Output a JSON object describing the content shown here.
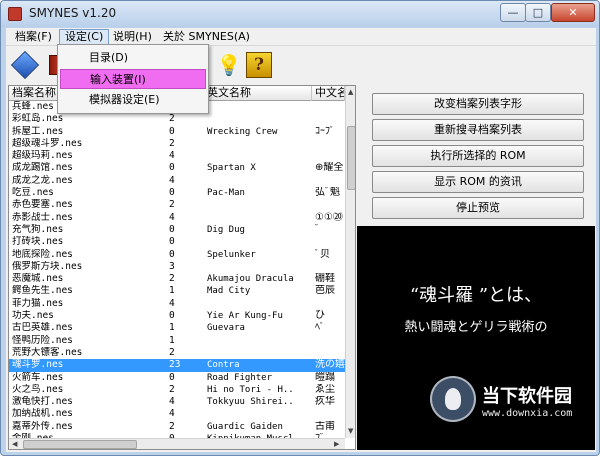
{
  "window": {
    "title": "SMYNES v1.20",
    "minimize": "—",
    "maximize": "□",
    "close": "✕"
  },
  "menu": [
    {
      "label": "档案(F)"
    },
    {
      "label": "设定(C)"
    },
    {
      "label": "说明(H)"
    },
    {
      "label": "关於 SMYNES(A)"
    }
  ],
  "dropdown": [
    "目录(D)",
    "输入装置(I)",
    "模拟器设定(E)"
  ],
  "toolbar": {
    "help_glyph": "?"
  },
  "columns": [
    "档案名称",
    "",
    "英文名称",
    "中文名"
  ],
  "rows": [
    {
      "file": "兵蜂.nes",
      "num": "0",
      "en": "",
      "cn": ""
    },
    {
      "file": "彩虹岛.nes",
      "num": "2",
      "en": "",
      "cn": ""
    },
    {
      "file": "拆屋工.nes",
      "num": "0",
      "en": "Wrecking Crew",
      "cn": "ｺｰﾌﾟ"
    },
    {
      "file": "超级魂斗罗.nes",
      "num": "2",
      "en": "",
      "cn": ""
    },
    {
      "file": "超级玛莉.nes",
      "num": "4",
      "en": "",
      "cn": ""
    },
    {
      "file": "成龙踢馆.nes",
      "num": "0",
      "en": "Spartan X",
      "cn": "⊕耀全"
    },
    {
      "file": "成龙之龙.nes",
      "num": "4",
      "en": "",
      "cn": ""
    },
    {
      "file": "吃豆.nes",
      "num": "0",
      "en": "Pac-Man",
      "cn": "弘ﾞ魁"
    },
    {
      "file": "赤色要塞.nes",
      "num": "2",
      "en": "",
      "cn": ""
    },
    {
      "file": "赤影战士.nes",
      "num": "4",
      "en": "",
      "cn": "①①⑳"
    },
    {
      "file": "充气狗.nes",
      "num": "0",
      "en": "Dig Dug",
      "cn": "ﾞ"
    },
    {
      "file": "打砖块.nes",
      "num": "0",
      "en": "",
      "cn": ""
    },
    {
      "file": "地底探险.nes",
      "num": "0",
      "en": "Spelunker",
      "cn": "ﾟ贝"
    },
    {
      "file": "俄罗斯方块.nes",
      "num": "3",
      "en": "",
      "cn": ""
    },
    {
      "file": "恶魔城.nes",
      "num": "2",
      "en": "Akumajou Dracula",
      "cn": "硼鞋"
    },
    {
      "file": "鳄鱼先生.nes",
      "num": "1",
      "en": "Mad City",
      "cn": "芭辰"
    },
    {
      "file": "菲力猫.nes",
      "num": "4",
      "en": "",
      "cn": ""
    },
    {
      "file": "功夫.nes",
      "num": "0",
      "en": "Yie Ar Kung-Fu",
      "cn": "ひ"
    },
    {
      "file": "古巴英雄.nes",
      "num": "1",
      "en": "Guevara",
      "cn": "ﾍﾟ"
    },
    {
      "file": "怪鸭历险.nes",
      "num": "1",
      "en": "",
      "cn": ""
    },
    {
      "file": "荒野大镖客.nes",
      "num": "2",
      "en": "",
      "cn": ""
    },
    {
      "file": "魂斗罗.nes",
      "num": "23",
      "en": "Contra",
      "cn": "洗の嬉"
    },
    {
      "file": "火箭车.nes",
      "num": "0",
      "en": "Road Fighter",
      "cn": "皚蹋"
    },
    {
      "file": "火之鸟.nes",
      "num": "2",
      "en": "Hi no Tori - H..",
      "cn": "ゑ尘"
    },
    {
      "file": "激龟快打.nes",
      "num": "4",
      "en": "Tokkyuu Shirei..",
      "cn": "疚华"
    },
    {
      "file": "加纳战机.nes",
      "num": "4",
      "en": "",
      "cn": ""
    },
    {
      "file": "嘉蒂外传.nes",
      "num": "2",
      "en": "Guardic Gaiden",
      "cn": "古甫"
    },
    {
      "file": "金刚.nes",
      "num": "0",
      "en": "Kinnikuman Muscl..",
      "cn": "ﾌﾞ"
    }
  ],
  "actions": [
    "改变档案列表字形",
    "重新搜寻档案列表",
    "执行所选择的 ROM",
    "显示 ROM 的资讯",
    "停止预览"
  ],
  "preview": {
    "line1": "“魂斗羅 ”とは、",
    "line2": "熱い闘魂とゲリラ戦術の"
  },
  "watermark": {
    "title": "当下软件园",
    "url": "www.downxia.com"
  }
}
